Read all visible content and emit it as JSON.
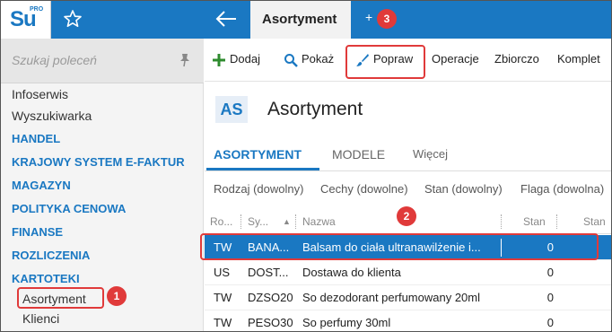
{
  "topbar": {
    "logo_text": "Su",
    "logo_sup": "PRO",
    "active_tab": "Asortyment",
    "next_tab_marker": "+"
  },
  "sidebar": {
    "search_placeholder": "Szukaj poleceń",
    "items": [
      {
        "label": "Infoserwis",
        "style": "plain"
      },
      {
        "label": "Wyszukiwarka",
        "style": "plain"
      },
      {
        "label": "HANDEL",
        "style": "upper"
      },
      {
        "label": "KRAJOWY SYSTEM E-FAKTUR",
        "style": "upper"
      },
      {
        "label": "MAGAZYN",
        "style": "upper"
      },
      {
        "label": "POLITYKA CENOWA",
        "style": "upper"
      },
      {
        "label": "FINANSE",
        "style": "upper"
      },
      {
        "label": "ROZLICZENIA",
        "style": "upper"
      },
      {
        "label": "KARTOTEKI",
        "style": "upper"
      },
      {
        "label": "Asortyment",
        "style": "sub"
      },
      {
        "label": "Klienci",
        "style": "sub"
      }
    ]
  },
  "toolbar": {
    "add_label": "Dodaj",
    "show_label": "Pokaż",
    "edit_label": "Popraw",
    "operations_label": "Operacje",
    "bulk_label": "Zbiorczo",
    "set_label": "Komplet"
  },
  "header": {
    "code": "AS",
    "title": "Asortyment"
  },
  "subtabs": {
    "active": "ASORTYMENT",
    "models": "MODELE",
    "more": "Więcej"
  },
  "filters": {
    "type": "Rodzaj (dowolny)",
    "features": "Cechy (dowolne)",
    "state": "Stan (dowolny)",
    "flag": "Flaga (dowolna)"
  },
  "grid": {
    "columns": [
      "Ro...",
      "Sy...",
      "Nazwa",
      "Stan",
      "Stan"
    ],
    "rows": [
      {
        "type": "TW",
        "symbol": "BANA...",
        "name": "Balsam do ciała ultranawilżenie i...",
        "stock": "0",
        "selected": true
      },
      {
        "type": "US",
        "symbol": "DOST...",
        "name": "Dostawa do klienta",
        "stock": "0",
        "selected": false
      },
      {
        "type": "TW",
        "symbol": "DZSO20",
        "name": "So dezodorant perfumowany 20ml",
        "stock": "0",
        "selected": false
      },
      {
        "type": "TW",
        "symbol": "PESO30",
        "name": "So perfumy 30ml",
        "stock": "0",
        "selected": false
      }
    ]
  },
  "annotations": {
    "step1": "1",
    "step2": "2",
    "step3": "3"
  },
  "colors": {
    "brand_blue": "#1a78c2",
    "annotation_red": "#e03a3a",
    "add_green": "#2e8b2e"
  }
}
